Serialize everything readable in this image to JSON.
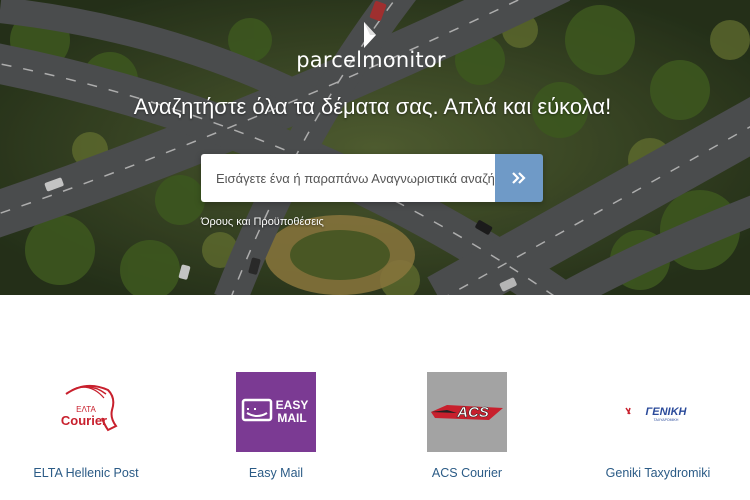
{
  "brand": {
    "name": "parcelmonitor"
  },
  "hero": {
    "headline": "Αναζητήστε όλα τα δέματα σας. Απλά και εύκολα!",
    "search_placeholder": "Εισάγετε ένα ή παραπάνω Αναγνωριστικά αναζήτησης",
    "search_button_icon": "double-chevron-right-icon",
    "terms_link": "Όρους και Προϋποθέσεις"
  },
  "carriers": [
    {
      "name": "ELTA Hellenic Post",
      "logo_text_top": "ΕΛΤΑ",
      "logo_text_bottom": "Courier"
    },
    {
      "name": "Easy Mail",
      "logo_text_top": "EASY",
      "logo_text_bottom": "MAIL"
    },
    {
      "name": "ACS Courier",
      "logo_text_top": "ACS"
    },
    {
      "name": "Geniki Taxydromiki",
      "logo_text_top": "ΓΕΝΙΚΗ",
      "logo_text_bottom": "ΤΑΧΥΔΡΟΜΙΚΗ"
    }
  ],
  "colors": {
    "search_button": "#6f9ac7",
    "carrier_link": "#2b5b86",
    "easy_mail_bg": "#7b3a93",
    "acs_bg": "#a3a3a3",
    "elta_red": "#c8202d"
  }
}
